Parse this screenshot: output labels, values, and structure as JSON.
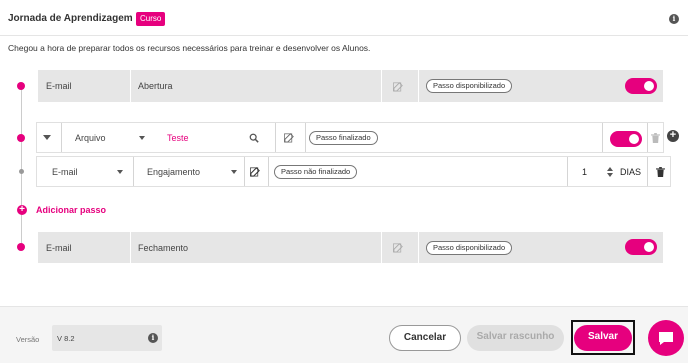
{
  "header": {
    "title": "Jornada de Aprendizagem",
    "badge": "Curso",
    "info_icon": "info-icon"
  },
  "description": "Chegou a hora de preparar todos os recursos necessários para treinar e desenvolver os Alunos.",
  "steps": [
    {
      "channel": "E-mail",
      "name": "Abertura",
      "status": "Passo disponibilizado",
      "enabled": true
    },
    {
      "type": "Arquivo",
      "value": "Teste",
      "status": "Passo finalizado",
      "enabled": true
    },
    {
      "channel": "E-mail",
      "name": "Engajamento",
      "status": "Passo não finalizado",
      "days": "1",
      "days_label": "DIAS"
    },
    {
      "channel": "E-mail",
      "name": "Fechamento",
      "status": "Passo disponibilizado",
      "enabled": true
    }
  ],
  "add_step_label": "Adicionar passo",
  "footer": {
    "version_label": "Versão",
    "version_value": "V 8.2",
    "cancel": "Cancelar",
    "save_draft": "Salvar rascunho",
    "save": "Salvar"
  },
  "colors": {
    "accent": "#e6007e",
    "gray_row": "#e6e6e6"
  }
}
